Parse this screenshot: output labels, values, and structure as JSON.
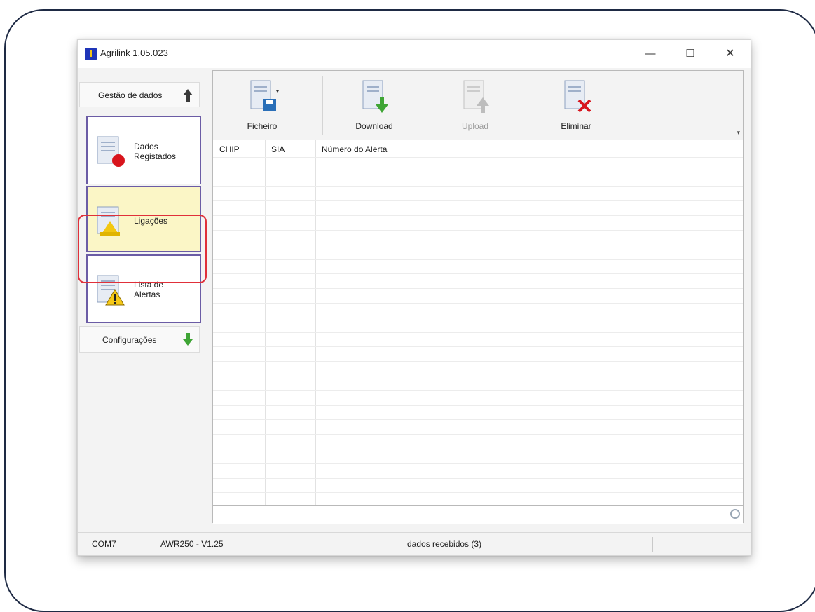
{
  "window": {
    "title": "Agrilink 1.05.023",
    "controls": {
      "minimize": "—",
      "maximize": "☐",
      "close": "✕"
    }
  },
  "sidebar": {
    "sections": [
      {
        "label": "Gestão de dados",
        "icon": "up-arrow-icon"
      },
      {
        "label": "Configurações",
        "icon": "down-arrow-icon"
      }
    ],
    "items": [
      {
        "label_line1": "Dados",
        "label_line2": "Registados",
        "icon": "recorded-data-icon"
      },
      {
        "label_line1": "Ligações",
        "label_line2": "",
        "icon": "connections-icon",
        "selected": true
      },
      {
        "label_line1": "Lista de",
        "label_line2": "Alertas",
        "icon": "alert-list-icon"
      }
    ]
  },
  "toolbar": {
    "buttons": [
      {
        "label": "Ficheiro",
        "icon": "file-save-icon",
        "enabled": true
      },
      {
        "label": "Download",
        "icon": "download-icon",
        "enabled": true
      },
      {
        "label": "Upload",
        "icon": "upload-icon",
        "enabled": false
      },
      {
        "label": "Eliminar",
        "icon": "delete-icon",
        "enabled": true
      }
    ]
  },
  "table": {
    "columns": [
      "CHIP",
      "SIA",
      "Número do Alerta"
    ],
    "rows": []
  },
  "statusbar": {
    "port": "COM7",
    "device": "AWR250 - V1.25",
    "message": "dados recebidos (3)"
  },
  "colors": {
    "selected_item_bg": "#fbf6c6",
    "selection_ring": "#e0303a",
    "item_border": "#6b5ca5",
    "app_icon": "#1f35b8"
  }
}
